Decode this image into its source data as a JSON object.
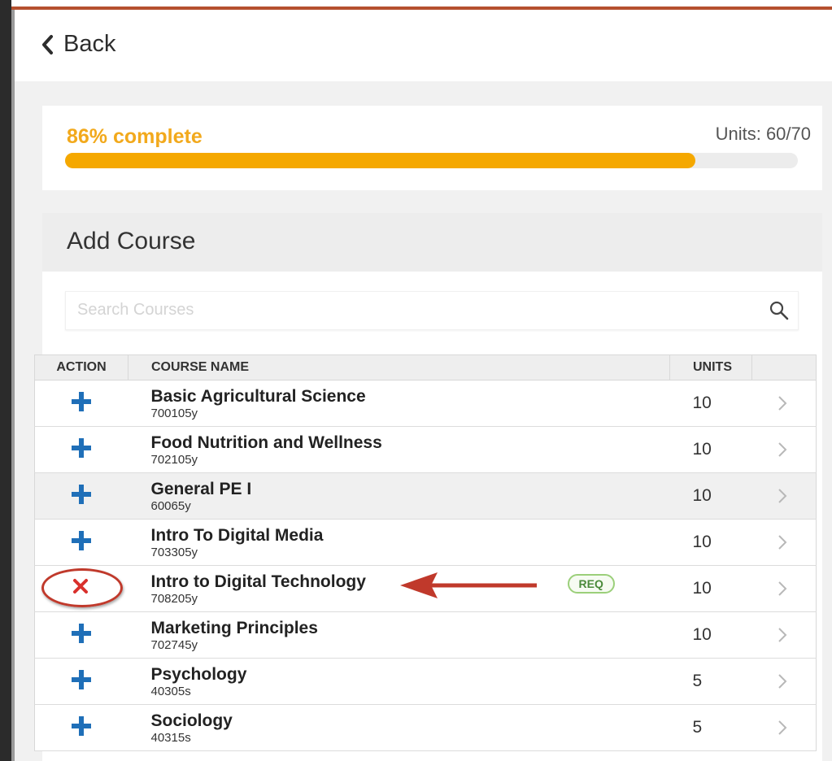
{
  "header": {
    "back_label": "Back"
  },
  "progress": {
    "label": "86% complete",
    "units_label": "Units: 60/70",
    "fraction": 0.86,
    "color": "#f5a800"
  },
  "add_course": {
    "title": "Add Course",
    "search_placeholder": "Search Courses"
  },
  "table": {
    "columns": {
      "action": "ACTION",
      "name": "COURSE NAME",
      "units": "UNITS"
    },
    "rows": [
      {
        "name": "Basic Agricultural Science",
        "code": "700105y",
        "units": "10",
        "action": "add"
      },
      {
        "name": "Food Nutrition and Wellness",
        "code": "702105y",
        "units": "10",
        "action": "add"
      },
      {
        "name": "General PE I",
        "code": "60065y",
        "units": "10",
        "action": "add"
      },
      {
        "name": "Intro To Digital Media",
        "code": "703305y",
        "units": "10",
        "action": "add"
      },
      {
        "name": "Intro to Digital Technology",
        "code": "708205y",
        "units": "10",
        "action": "remove",
        "badge": "REQ"
      },
      {
        "name": "Marketing Principles",
        "code": "702745y",
        "units": "10",
        "action": "add"
      },
      {
        "name": "Psychology",
        "code": "40305s",
        "units": "5",
        "action": "add"
      },
      {
        "name": "Sociology",
        "code": "40315s",
        "units": "5",
        "action": "add"
      }
    ]
  },
  "icons": {
    "back": "chevron-left-icon",
    "search": "search-icon",
    "add": "plus-icon",
    "remove": "close-icon",
    "row": "chevron-right-icon"
  },
  "colors": {
    "accent": "#f5a800",
    "add": "#1f6fb8",
    "remove": "#d9302c",
    "req": "#4a8a3a",
    "annotation": "#c0392b"
  }
}
